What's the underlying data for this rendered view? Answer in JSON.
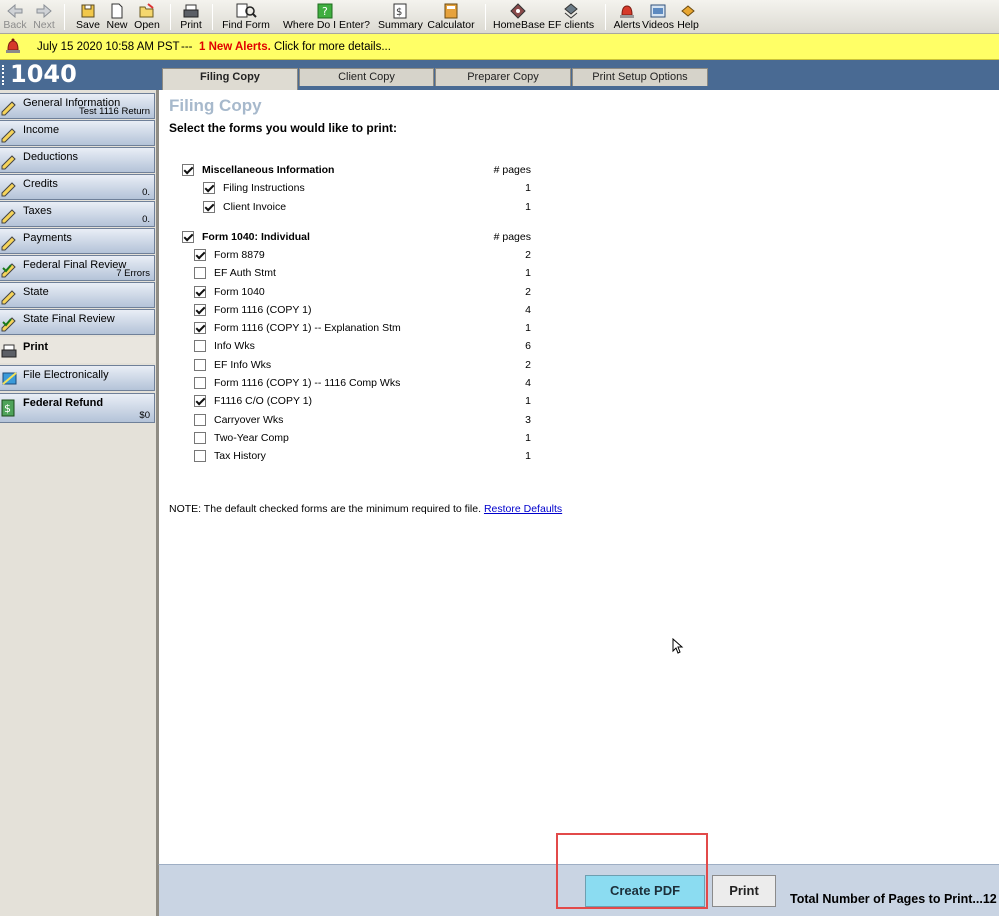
{
  "toolbar": {
    "back": "Back",
    "next": "Next",
    "save": "Save",
    "new": "New",
    "open": "Open",
    "print": "Print",
    "find_form": "Find Form",
    "where_do_i_enter": "Where Do I Enter?",
    "summary": "Summary",
    "calculator": "Calculator",
    "homebase": "HomeBase",
    "ef_clients": "EF clients",
    "alerts": "Alerts",
    "videos": "Videos",
    "help": "Help"
  },
  "alert": {
    "datetime": "July 15 2020 10:58 AM PST",
    "separator": "---",
    "count": "1 New Alerts.",
    "message": "Click for more details..."
  },
  "header": {
    "form": "1040"
  },
  "tabs": [
    {
      "label": "Filing Copy",
      "active": true
    },
    {
      "label": "Client Copy",
      "active": false
    },
    {
      "label": "Preparer Copy",
      "active": false
    },
    {
      "label": "Print Setup Options",
      "active": false
    }
  ],
  "sidebar": {
    "items": [
      {
        "label": "General Information",
        "sub": "Test 1116 Return",
        "icon": "pencil-icon"
      },
      {
        "label": "Income",
        "sub": "",
        "icon": "pencil-icon"
      },
      {
        "label": "Deductions",
        "sub": "",
        "icon": "pencil-icon"
      },
      {
        "label": "Credits",
        "sub": "0.",
        "icon": "pencil-icon"
      },
      {
        "label": "Taxes",
        "sub": "0.",
        "icon": "pencil-icon"
      },
      {
        "label": "Payments",
        "sub": "",
        "icon": "pencil-icon"
      },
      {
        "label": "Federal Final Review",
        "sub": "7 Errors",
        "icon": "check-icon"
      },
      {
        "label": "State",
        "sub": "",
        "icon": "pencil-icon"
      },
      {
        "label": "State Final Review",
        "sub": "",
        "icon": "check-icon"
      },
      {
        "label": "Print",
        "sub": "",
        "icon": "printer-icon"
      },
      {
        "label": "File Electronically",
        "sub": "",
        "icon": "globe-icon"
      },
      {
        "label": "Federal Refund",
        "sub": "$0",
        "icon": "money-icon"
      }
    ]
  },
  "main": {
    "title": "Filing Copy",
    "instruction": "Select the forms you would like to print:",
    "pages_header": "# pages",
    "groups": [
      {
        "label": "Miscellaneous Information",
        "checked": true,
        "items": [
          {
            "label": "Filing Instructions",
            "checked": true,
            "pages": "1"
          },
          {
            "label": "Client Invoice",
            "checked": true,
            "pages": "1"
          }
        ]
      },
      {
        "label": "Form 1040: Individual",
        "checked": true,
        "items": [
          {
            "label": "Form 8879",
            "checked": true,
            "pages": "2"
          },
          {
            "label": "EF Auth Stmt",
            "checked": false,
            "pages": "1"
          },
          {
            "label": "Form 1040",
            "checked": true,
            "pages": "2"
          },
          {
            "label": "Form 1116 (COPY 1)",
            "checked": true,
            "pages": "4"
          },
          {
            "label": "Form 1116 (COPY 1) -- Explanation Stm",
            "checked": true,
            "pages": "1"
          },
          {
            "label": "Info Wks",
            "checked": false,
            "pages": "6"
          },
          {
            "label": "EF Info Wks",
            "checked": false,
            "pages": "2"
          },
          {
            "label": "Form 1116 (COPY 1) -- 1116 Comp Wks",
            "checked": false,
            "pages": "4"
          },
          {
            "label": "F1116 C/O (COPY 1)",
            "checked": true,
            "pages": "1"
          },
          {
            "label": "Carryover Wks",
            "checked": false,
            "pages": "3"
          },
          {
            "label": "Two-Year Comp",
            "checked": false,
            "pages": "1"
          },
          {
            "label": "Tax History",
            "checked": false,
            "pages": "1"
          }
        ]
      }
    ],
    "note": "NOTE: The default checked forms are the minimum required to file.",
    "restore_link": "Restore Defaults"
  },
  "bottom": {
    "create_pdf": "Create PDF",
    "print": "Print",
    "total": "Total Number of Pages to Print...12"
  },
  "colors": {
    "header_bar": "#496a93",
    "alert_bg": "#ffff66",
    "alert_count": "#e00000",
    "pdf_button": "#8bdcf1",
    "highlight": "#e24a4a"
  }
}
